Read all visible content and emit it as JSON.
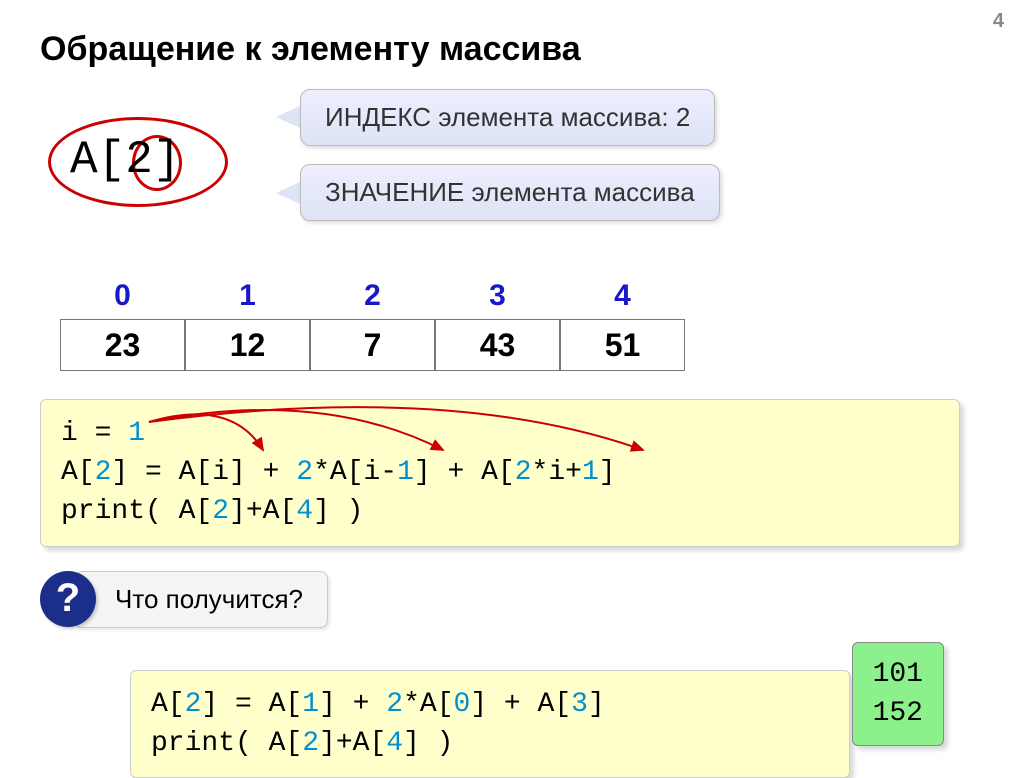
{
  "page_number": "4",
  "title": "Обращение к элементу массива",
  "access_expr": "A[2]",
  "callout_index": "ИНДЕКС элемента массива: 2",
  "callout_value": "ЗНАЧЕНИЕ элемента массива",
  "array": {
    "indices": [
      "0",
      "1",
      "2",
      "3",
      "4"
    ],
    "values": [
      "23",
      "12",
      "7",
      "43",
      "51"
    ]
  },
  "code1": {
    "line1_a": "i = ",
    "line1_n": "1",
    "line2_a": "A[",
    "line2_n1": "2",
    "line2_b": "] = A[i] + ",
    "line2_n2": "2",
    "line2_c": "*A[i-",
    "line2_n3": "1",
    "line2_d": "] + A[",
    "line2_n4": "2",
    "line2_e": "*i+",
    "line2_n5": "1",
    "line2_f": "]",
    "line3_a": "print( A[",
    "line3_n1": "2",
    "line3_b": "]+A[",
    "line3_n2": "4",
    "line3_c": "] )"
  },
  "question_mark": "?",
  "question_text": "Что получится?",
  "code2": {
    "line1_a": "A[",
    "line1_n1": "2",
    "line1_b": "] = A[",
    "line1_n2": "1",
    "line1_c": "] + ",
    "line1_n3": "2",
    "line1_d": "*A[",
    "line1_n4": "0",
    "line1_e": "] + A[",
    "line1_n5": "3",
    "line1_f": "]",
    "line2_a": "print( A[",
    "line2_n1": "2",
    "line2_b": "]+A[",
    "line2_n2": "4",
    "line2_c": "] )"
  },
  "results": {
    "r1": "101",
    "r2": "152"
  }
}
